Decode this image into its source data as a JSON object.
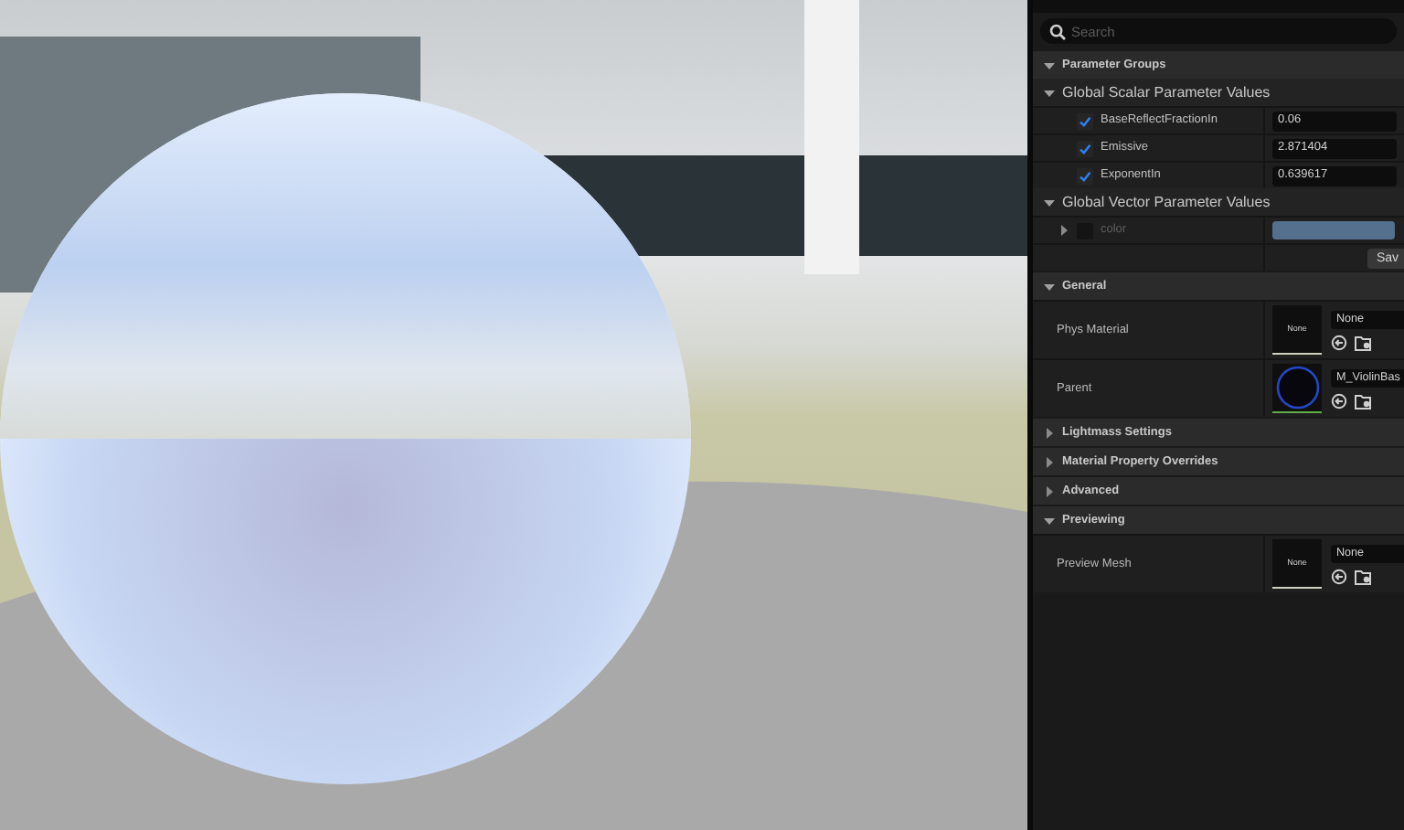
{
  "viewport": {
    "kind": "material-preview"
  },
  "search": {
    "placeholder": "Search"
  },
  "parameter_groups": {
    "title": "Parameter Groups",
    "expanded": true,
    "groups": [
      {
        "title": "Global Scalar Parameter Values",
        "expanded": true,
        "params": [
          {
            "kind": "scalar",
            "name": "BaseReflectFractionIn",
            "checked": true,
            "value": "0.06"
          },
          {
            "kind": "scalar",
            "name": "Emissive",
            "checked": true,
            "value": "2.871404"
          },
          {
            "kind": "scalar",
            "name": "ExponentIn",
            "checked": true,
            "value": "0.639617"
          }
        ]
      },
      {
        "title": "Global Vector Parameter Values",
        "expanded": true,
        "params": [
          {
            "kind": "vector",
            "name": "color",
            "checked": false,
            "expanded": false,
            "color": "#55708e"
          }
        ]
      }
    ],
    "save_button": "Sav"
  },
  "categories": [
    {
      "title": "General",
      "expanded": true,
      "properties": [
        {
          "name": "Phys Material",
          "thumbnail": {
            "kind": "text",
            "label": "None"
          },
          "value": "None"
        },
        {
          "name": "Parent",
          "thumbnail": {
            "kind": "sphere"
          },
          "value": "M_ViolinBas"
        }
      ]
    },
    {
      "title": "Lightmass Settings",
      "expanded": false
    },
    {
      "title": "Material Property Overrides",
      "expanded": false
    },
    {
      "title": "Advanced",
      "expanded": false
    },
    {
      "title": "Previewing",
      "expanded": true,
      "properties": [
        {
          "name": "Preview Mesh",
          "thumbnail": {
            "kind": "text",
            "label": "None"
          },
          "value": "None"
        }
      ]
    }
  ]
}
